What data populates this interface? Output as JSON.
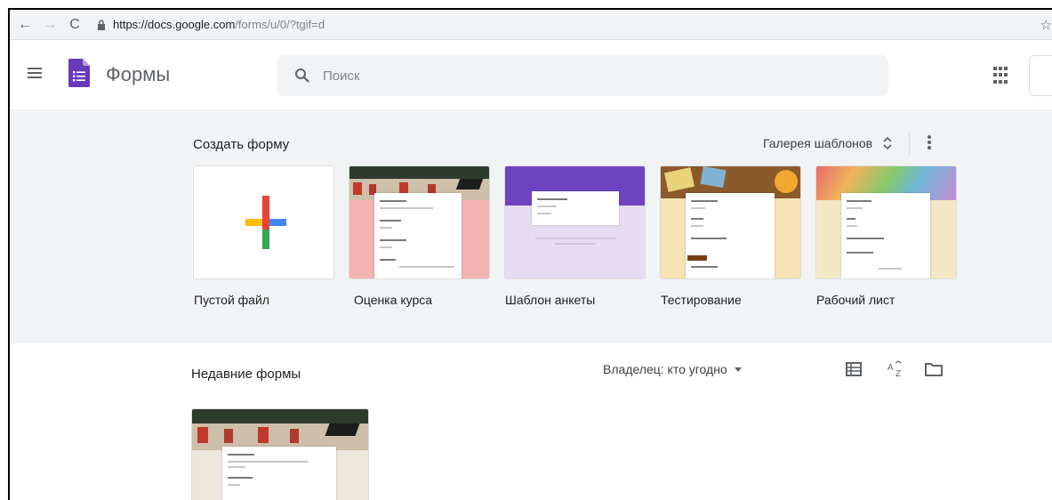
{
  "browser": {
    "url_host": "https://docs.google.com",
    "url_path": "/forms/u/0/?tgif=d"
  },
  "header": {
    "app_name": "Формы",
    "search_placeholder": "Поиск"
  },
  "templates": {
    "heading": "Создать форму",
    "gallery_label": "Галерея шаблонов",
    "items": [
      {
        "label": "Пустой файл"
      },
      {
        "label": "Оценка курса"
      },
      {
        "label": "Шаблон анкеты"
      },
      {
        "label": "Тестирование"
      },
      {
        "label": "Рабочий лист"
      }
    ]
  },
  "recent": {
    "heading": "Недавние формы",
    "owner_filter": "Владелец: кто угодно"
  },
  "colors": {
    "forms_purple": "#673ab7",
    "section_bg": "#f1f3f4",
    "survey_purple": "#6f42c1",
    "course_pink": "#f4b4b4"
  }
}
